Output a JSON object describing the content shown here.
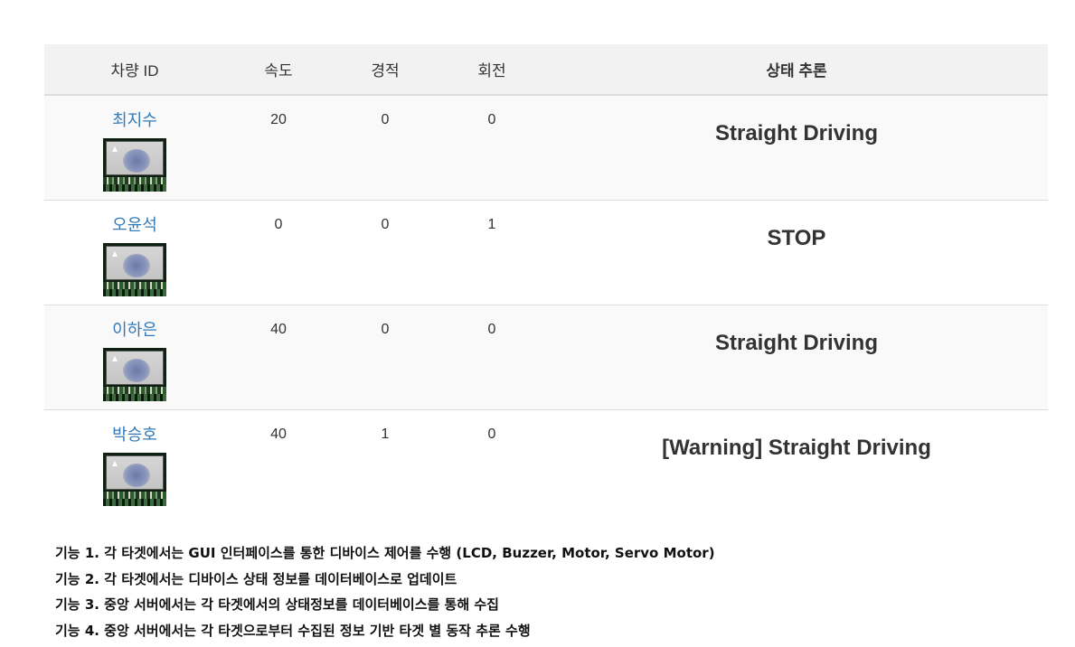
{
  "table": {
    "headers": {
      "vehicle_id": "차량 ID",
      "speed": "속도",
      "horn": "경적",
      "turn": "회전",
      "state": "상태 추론"
    },
    "rows": [
      {
        "name": "최지수",
        "speed": "20",
        "horn": "0",
        "turn": "0",
        "state": "Straight Driving",
        "thumbnail_icon": "device-board-photo"
      },
      {
        "name": "오윤석",
        "speed": "0",
        "horn": "0",
        "turn": "1",
        "state": "STOP",
        "thumbnail_icon": "device-board-photo"
      },
      {
        "name": "이하은",
        "speed": "40",
        "horn": "0",
        "turn": "0",
        "state": "Straight Driving",
        "thumbnail_icon": "device-board-photo"
      },
      {
        "name": "박승호",
        "speed": "40",
        "horn": "1",
        "turn": "0",
        "state": "[Warning] Straight Driving",
        "thumbnail_icon": "device-board-photo"
      }
    ]
  },
  "notes": [
    "기능 1. 각 타겟에서는 GUI 인터페이스를 통한 디바이스 제어를 수행 (LCD, Buzzer, Motor, Servo Motor)",
    "기능 2. 각 타겟에서는 디바이스 상태 정보를 데이터베이스로 업데이트",
    "기능 3. 중앙 서버에서는 각 타겟에서의 상태정보를 데이터베이스를 통해 수집",
    "기능 4. 중앙 서버에서는 각 타겟으로부터 수집된 정보 기반 타겟 별 동작 추론 수행"
  ],
  "colors": {
    "link": "#337ab7",
    "header_bg": "#f2f2f2",
    "stripe_bg": "#f9f9f9",
    "text": "#333333"
  }
}
